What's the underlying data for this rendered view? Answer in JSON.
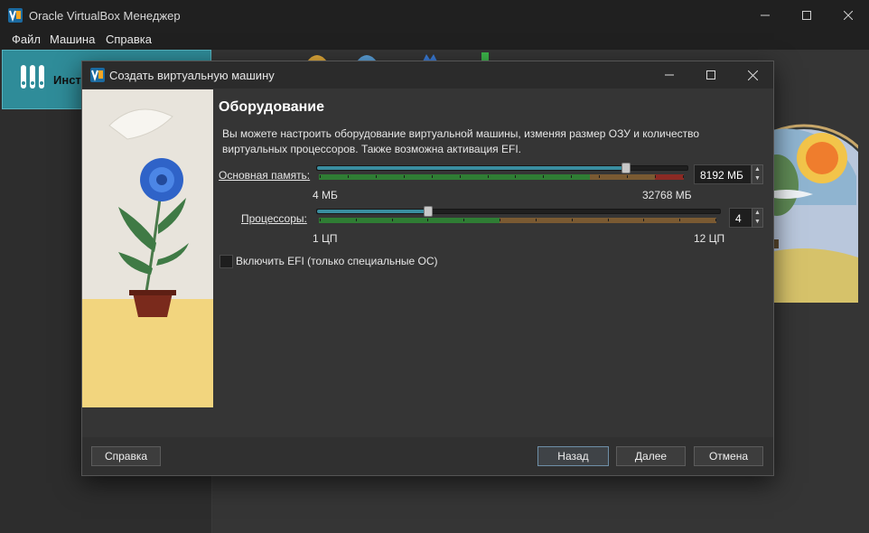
{
  "app": {
    "title": "Oracle VirtualBox Менеджер"
  },
  "menu": [
    {
      "label": "Файл"
    },
    {
      "label": "Машина"
    },
    {
      "label": "Справка"
    }
  ],
  "sidebar": {
    "tools_label": "Инстр",
    "tools_icon": "tools-icon"
  },
  "dialog": {
    "title": "Создать виртуальную машину",
    "page_title": "Оборудование",
    "description": "Вы можете настроить оборудование виртуальной машины, изменяя размер ОЗУ и количество виртуальных процессоров. Также возможна активация EFI.",
    "memory": {
      "label": "Основная память:",
      "value_text": "8192 МБ",
      "min_label": "4 МБ",
      "max_label": "32768 МБ",
      "value": 8192,
      "min": 4,
      "max": 32768
    },
    "cpu": {
      "label": "Процессоры:",
      "value_text": "4",
      "min_label": "1 ЦП",
      "max_label": "12 ЦП",
      "value": 4,
      "min": 1,
      "max": 12
    },
    "efi": {
      "label": "Включить EFI (только специальные ОС)",
      "checked": false
    },
    "buttons": {
      "help": "Справка",
      "back": "Назад",
      "next": "Далее",
      "cancel": "Отмена"
    }
  },
  "colors": {
    "accent": "#2f8c99",
    "slider_fill": "#3a8ea0",
    "segment_ok": "#2f7d34",
    "segment_warn": "#7a5a32",
    "segment_bad": "#8b2a24"
  }
}
